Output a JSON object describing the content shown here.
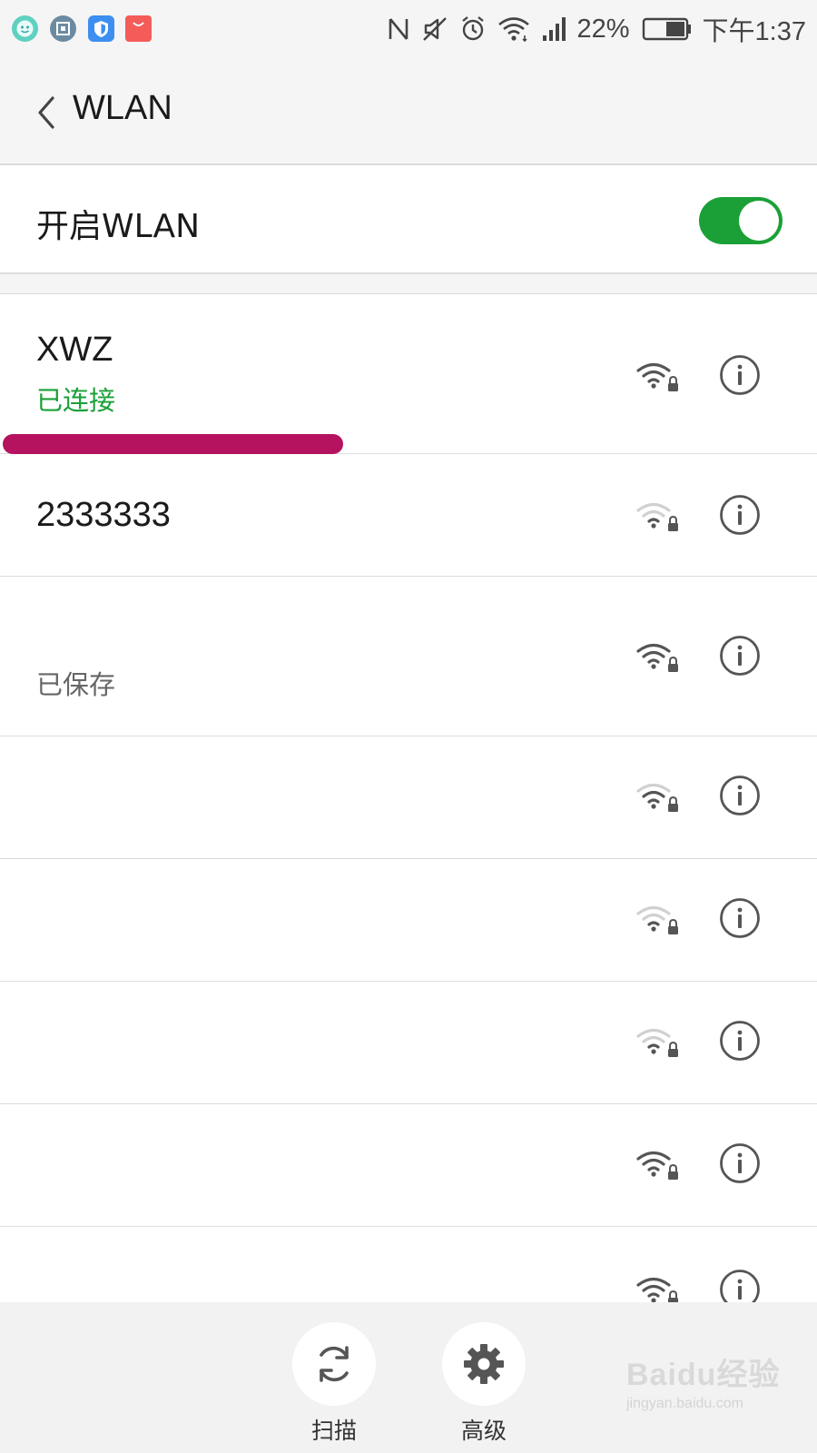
{
  "status_bar": {
    "app_icons": [
      "chat-app-icon",
      "screenshot-app-icon",
      "security-shield-icon",
      "store-bag-icon"
    ],
    "indicators": [
      "nfc-icon",
      "mute-icon",
      "alarm-icon",
      "wifi-status-icon",
      "cellular-signal-icon"
    ],
    "battery_percent": "22%",
    "battery_level": 0.22,
    "time": "下午1:37"
  },
  "header": {
    "title": "WLAN",
    "back_icon": "chevron-left-icon"
  },
  "wlan_switch": {
    "label": "开启WLAN",
    "enabled": true,
    "accent_color": "#1aa037"
  },
  "networks": [
    {
      "name": "XWZ",
      "status": "已连接",
      "status_color": "#1aa037",
      "signal": "strong",
      "secured": true
    },
    {
      "name": "2333333",
      "status": "",
      "signal": "weak",
      "secured": true
    },
    {
      "name": "",
      "status": "已保存",
      "status_color": "#666666",
      "signal": "strong",
      "secured": true
    },
    {
      "name": "",
      "status": "",
      "signal": "medium",
      "secured": true
    },
    {
      "name": "",
      "status": "",
      "signal": "weak",
      "secured": true
    },
    {
      "name": "",
      "status": "",
      "signal": "weak",
      "secured": true
    },
    {
      "name": "",
      "status": "",
      "signal": "strong",
      "secured": true
    },
    {
      "name": "",
      "status": "",
      "signal": "strong",
      "secured": true
    }
  ],
  "annotation_color": "#b5135f",
  "bottom_bar": {
    "scan_label": "扫描",
    "scan_icon": "refresh-icon",
    "advanced_label": "高级",
    "advanced_icon": "gear-icon"
  },
  "watermark": {
    "logo": "Baidu经验",
    "url": "jingyan.baidu.com"
  }
}
